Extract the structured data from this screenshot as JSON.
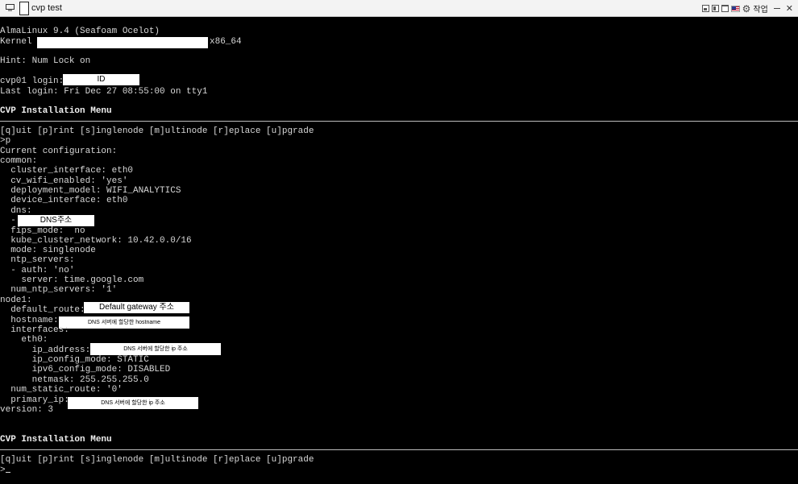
{
  "window": {
    "title": "cvp test",
    "lang_label": "작업"
  },
  "console": {
    "os_line": "AlmaLinux 9.4 (Seafoam Ocelot)",
    "kernel_label": "Kernel",
    "kernel_arch": "x86_64",
    "hint": "Hint: Num Lock on",
    "login_prompt": "cvp01 login:",
    "login_mask": "ID",
    "last_login": "Last login: Fri Dec 27 08:55:00 on tty1",
    "menu_title_1": "CVP Installation Menu",
    "menu_options_1": "[q]uit [p]rint [s]inglenode [m]ultinode [r]eplace [u]pgrade",
    "command": ">p",
    "current_config": "Current configuration:",
    "common": "common:",
    "cluster_interface": "  cluster_interface: eth0",
    "cv_wifi_enabled": "  cv_wifi_enabled: 'yes'",
    "deployment_model": "  deployment_model: WIFI_ANALYTICS",
    "device_interface": "  device_interface: eth0",
    "dns": "  dns:",
    "dns_item": "  -",
    "dns_mask": "DNS주소",
    "fips_mode": "  fips_mode:  no",
    "kube_cluster_network": "  kube_cluster_network: 10.42.0.0/16",
    "mode": "  mode: singlenode",
    "ntp_servers": "  ntp_servers:",
    "auth": "  - auth: 'no'",
    "server": "    server: time.google.com",
    "num_ntp_servers": "  num_ntp_servers: '1'",
    "node1": "node1:",
    "default_route": "  default_route:",
    "default_route_mask": "Default gateway 주소",
    "hostname": "  hostname:",
    "hostname_mask": "DNS 서버에 할당한 hostname",
    "interfaces": "  interfaces:",
    "eth0": "    eth0:",
    "ip_address": "      ip_address:",
    "ip_address_mask": "DNS 서버에 할당한 ip 주소",
    "ip_config_mode": "      ip_config_mode: STATIC",
    "ipv6_config_mode": "      ipv6_config_mode: DISABLED",
    "netmask": "      netmask: 255.255.255.0",
    "num_static_route": "  num_static_route: '0'",
    "primary_ip": "  primary_ip:",
    "primary_ip_mask": "DNS 서버에 할당한 ip 주소",
    "version": "version: 3",
    "menu_title_2": "CVP Installation Menu",
    "menu_options_2": "[q]uit [p]rint [s]inglenode [m]ultinode [r]eplace [u]pgrade",
    "prompt": ">"
  },
  "colors": {
    "console_bg": "#000000",
    "console_fg": "#d8d8d8",
    "titlebar_bg": "#f3f3f3"
  },
  "icons": {
    "app": "monitor-icon",
    "settings": "gear-icon",
    "flag": "us-flag-icon"
  }
}
